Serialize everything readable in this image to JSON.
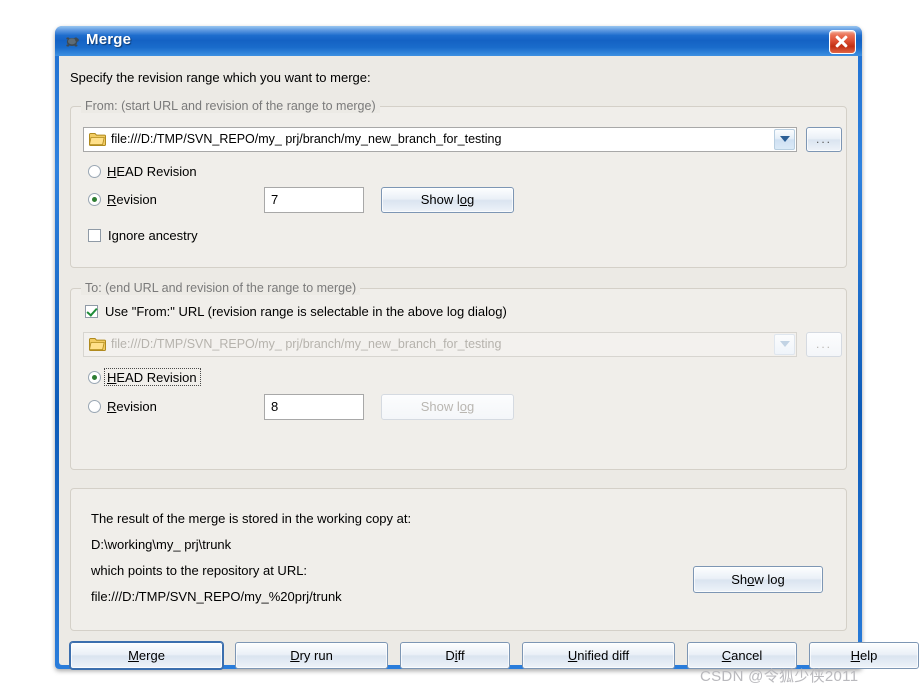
{
  "window": {
    "title": "Merge",
    "icon": "turtle-icon",
    "close_label": "×",
    "accent_titlebar": "#1462c4",
    "client_bg": "#eceae5"
  },
  "intro": {
    "text": "Specify the revision range which you want to merge:"
  },
  "from_group": {
    "title": "From: (start URL and revision of the range to merge)",
    "url": "file:///D:/TMP/SVN_REPO/my_ prj/branch/my_new_branch_for_testing",
    "browse_label": "...",
    "head_revision": {
      "label_pre": "",
      "label_accel": "H",
      "label_post": "EAD Revision",
      "checked": false
    },
    "revision": {
      "label_accel": "R",
      "label_post": "evision",
      "checked": true
    },
    "revision_value": "7",
    "show_log": {
      "pre": "Show l",
      "accel": "o",
      "post": "g",
      "disabled": false
    },
    "ignore_ancestry": {
      "label": "Ignore ancestry",
      "checked": false
    }
  },
  "to_group": {
    "title": "To: (end URL and revision of the range to merge)",
    "use_from_url": {
      "label": "Use \"From:\" URL (revision range is selectable in the above log dialog)",
      "checked": true
    },
    "url": "file:///D:/TMP/SVN_REPO/my_ prj/branch/my_new_branch_for_testing",
    "url_disabled": true,
    "browse_label": "...",
    "head_revision": {
      "label_accel": "H",
      "label_post": "EAD Revision",
      "checked": true,
      "focused": true
    },
    "revision": {
      "label_accel": "R",
      "label_post": "evision",
      "checked": false
    },
    "revision_value": "8",
    "show_log": {
      "pre": "Show l",
      "accel": "o",
      "post": "g",
      "disabled": true
    }
  },
  "result_group": {
    "line1": "The result of the merge is stored in the working copy at:",
    "line2": "D:\\working\\my_ prj\\trunk",
    "line3": "which points to the repository at URL:",
    "line4": "file:///D:/TMP/SVN_REPO/my_%20prj/trunk",
    "show_log": {
      "pre": "Sh",
      "accel": "o",
      "post": "w log"
    }
  },
  "buttons": [
    {
      "name": "merge",
      "pre": "",
      "accel": "M",
      "post": "erge",
      "default": true
    },
    {
      "name": "dry-run",
      "pre": "",
      "accel": "D",
      "post": "ry run",
      "default": false
    },
    {
      "name": "diff",
      "pre": "D",
      "accel": "i",
      "post": "ff",
      "default": false
    },
    {
      "name": "unified-diff",
      "pre": "",
      "accel": "U",
      "post": "nified diff",
      "default": false
    },
    {
      "name": "cancel",
      "pre": "",
      "accel": "C",
      "post": "ancel",
      "default": false
    },
    {
      "name": "help",
      "pre": "",
      "accel": "H",
      "post": "elp",
      "default": false
    }
  ],
  "watermark": {
    "text": "CSDN @令狐少侠2011"
  }
}
